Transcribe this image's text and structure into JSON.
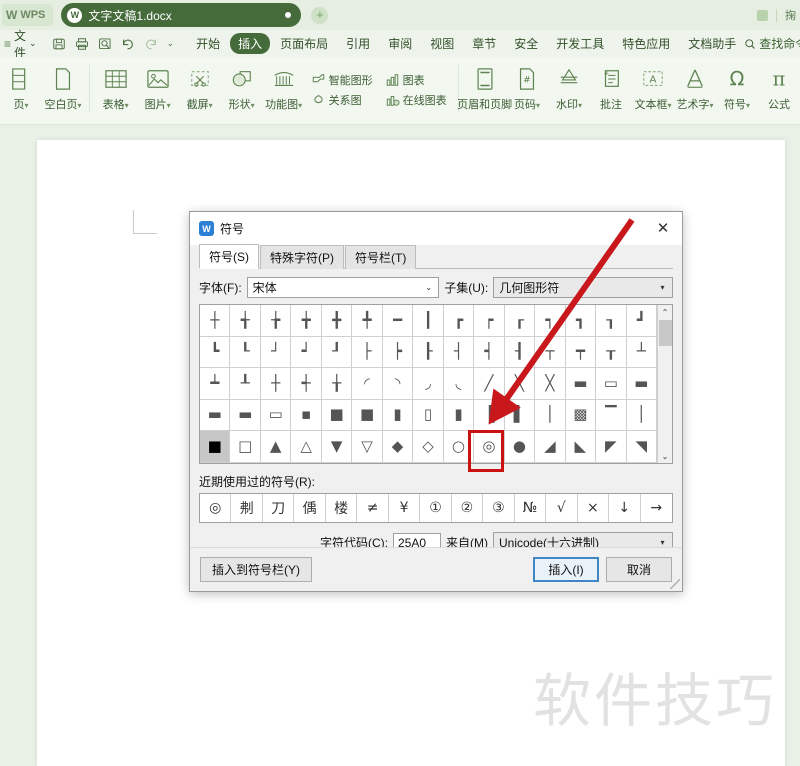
{
  "app": {
    "brand": "WPS",
    "brand_mark": "W",
    "tab": {
      "icon": "W",
      "title": "文字文稿1.docx",
      "modified_dot": "●"
    },
    "add_tab": "+",
    "titlebar_right": {
      "search_hint": "掬"
    }
  },
  "menubar": {
    "hamburger": "≡",
    "file_label": "文件",
    "file_caret": "⌄",
    "quick_access": [
      {
        "name": "save-icon",
        "glyph": "🖫"
      },
      {
        "name": "print-icon",
        "glyph": "🖨"
      },
      {
        "name": "print-preview-icon",
        "glyph": "🔍"
      },
      {
        "name": "undo-icon",
        "glyph": "↺"
      },
      {
        "name": "redo-icon",
        "glyph": "↻"
      },
      {
        "name": "customize-caret-icon",
        "glyph": "⌄"
      }
    ],
    "tabs": [
      {
        "label": "开始",
        "active": false
      },
      {
        "label": "插入",
        "active": true
      },
      {
        "label": "页面布局",
        "active": false
      },
      {
        "label": "引用",
        "active": false
      },
      {
        "label": "审阅",
        "active": false
      },
      {
        "label": "视图",
        "active": false
      },
      {
        "label": "章节",
        "active": false
      },
      {
        "label": "安全",
        "active": false
      },
      {
        "label": "开发工具",
        "active": false
      },
      {
        "label": "特色应用",
        "active": false
      },
      {
        "label": "文档助手",
        "active": false
      }
    ],
    "find": {
      "icon": "search-icon",
      "label": "查找命令..."
    }
  },
  "ribbon": {
    "buttons": [
      {
        "label": "页",
        "caret": "▾",
        "icon": "page-icon",
        "truncated": true
      },
      {
        "label": "空白页",
        "caret": "▾",
        "icon": "blank-page-icon"
      },
      {
        "label": "表格",
        "caret": "▾",
        "icon": "table-icon"
      },
      {
        "label": "图片",
        "caret": "▾",
        "icon": "picture-icon"
      },
      {
        "label": "截屏",
        "caret": "▾",
        "icon": "screenshot-icon"
      },
      {
        "label": "形状",
        "caret": "▾",
        "icon": "shapes-icon"
      },
      {
        "label": "功能图",
        "caret": "▾",
        "icon": "function-chart-icon"
      },
      {
        "label": "页眉和页脚",
        "caret": "",
        "icon": "header-footer-icon"
      },
      {
        "label": "页码",
        "caret": "▾",
        "icon": "page-number-icon"
      },
      {
        "label": "水印",
        "caret": "▾",
        "icon": "watermark-icon"
      },
      {
        "label": "批注",
        "caret": "",
        "icon": "comment-icon"
      },
      {
        "label": "文本框",
        "caret": "▾",
        "icon": "textbox-icon"
      },
      {
        "label": "艺术字",
        "caret": "▾",
        "icon": "wordart-icon"
      },
      {
        "label": "符号",
        "caret": "▾",
        "icon": "omega-symbol-icon"
      },
      {
        "label": "公式",
        "caret": "",
        "icon": "pi-formula-icon"
      }
    ],
    "stacked": [
      {
        "label": "智能图形",
        "icon": "smartart-icon"
      },
      {
        "label": "关系图",
        "icon": "relation-chart-icon"
      },
      {
        "label": "图表",
        "icon": "chart-icon"
      },
      {
        "label": "在线图表",
        "icon": "online-chart-icon"
      }
    ]
  },
  "document": {
    "watermark": "软件技巧"
  },
  "dialog": {
    "icon": "wps-symbol-icon",
    "title": "符号",
    "close": "✕",
    "tabs": [
      {
        "label": "符号(S)",
        "active": true
      },
      {
        "label": "特殊字符(P)",
        "active": false
      },
      {
        "label": "符号栏(T)",
        "active": false
      }
    ],
    "font": {
      "label": "字体(F):",
      "value": "宋体",
      "arrow": "⌄"
    },
    "subset": {
      "label": "子集(U):",
      "value": "几何图形符",
      "arrow": "▾"
    },
    "symbol_grid": {
      "rows": [
        [
          "┼",
          "╅",
          "╆",
          "╈",
          "╋",
          "╇",
          "━",
          "┃",
          "┏",
          "┍",
          "┎",
          "┑",
          "┓",
          "┒",
          "┛"
        ],
        [
          "┗",
          "┖",
          "┘",
          "┙",
          "┚",
          "├",
          "┝",
          "┠",
          "┤",
          "┥",
          "┨",
          "┬",
          "┯",
          "┰",
          "┴"
        ],
        [
          "┷",
          "┸",
          "┼",
          "┽",
          "╁",
          "◜",
          "◝",
          "◞",
          "◟",
          "╱",
          "╲",
          "╳",
          "▬",
          "▭",
          "▬"
        ],
        [
          "▬",
          "▬",
          "▭",
          "▪",
          "■",
          "■",
          "▮",
          "▯",
          "▮",
          "▐",
          "▌",
          "│",
          "▩",
          "▔",
          "│"
        ],
        [
          "■",
          "□",
          "▲",
          "△",
          "▼",
          "▽",
          "◆",
          "◇",
          "○",
          "◎",
          "●",
          "◢",
          "◣",
          "◤",
          "◥"
        ]
      ],
      "selected": {
        "row": 4,
        "col": 0,
        "symbol": "■"
      },
      "highlight": {
        "row": 4,
        "col": 9,
        "symbol": "◎"
      },
      "scrollbar": {
        "up": "⌃",
        "down": "⌄"
      }
    },
    "recent": {
      "label": "近期使用过的符号(R):",
      "symbols": [
        "◎",
        "刜",
        "刀",
        "偊",
        "楼",
        "≠",
        "¥",
        "①",
        "②",
        "③",
        "№",
        "√",
        "×",
        "↓",
        "→"
      ]
    },
    "charcode": {
      "label": "字符代码(C):",
      "value": "25A0"
    },
    "from": {
      "label": "来自(M)",
      "value": "Unicode(十六进制)",
      "arrow": "▾"
    },
    "buttons": {
      "insert_to_bar": "插入到符号栏(Y)",
      "insert": "插入(I)",
      "cancel": "取消"
    }
  },
  "annotations": {
    "arrow_color": "#c8181b",
    "box_color": "#cc1111"
  }
}
